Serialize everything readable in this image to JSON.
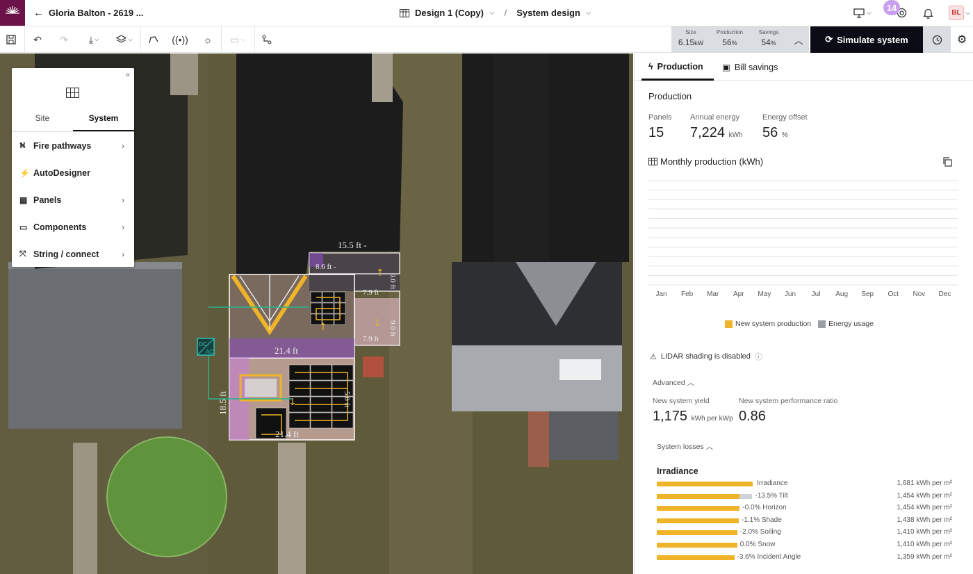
{
  "header": {
    "project_title": "Gloria Balton - 2619 ...",
    "design_name": "Design 1 (Copy)",
    "separator": "/",
    "page_name": "System design",
    "notification_count": "14",
    "avatar_initials": "BL"
  },
  "stats": {
    "size_label": "Size",
    "size_value": "6.15",
    "size_unit": "kW",
    "production_label": "Production",
    "production_value": "56",
    "production_unit": "%",
    "savings_label": "Savings",
    "savings_value": "54",
    "savings_unit": "%"
  },
  "simulate_label": "Simulate system",
  "left_panel": {
    "tabs": [
      "Site",
      "System"
    ],
    "active_tab": "System",
    "items": [
      {
        "label": "Fire pathways",
        "icon": "fire-pathway-icon",
        "chevron": true
      },
      {
        "label": "AutoDesigner",
        "icon": "magic-wand-icon",
        "chevron": false
      },
      {
        "label": "Panels",
        "icon": "grid-icon",
        "chevron": true
      },
      {
        "label": "Components",
        "icon": "component-icon",
        "chevron": true
      },
      {
        "label": "String / connect",
        "icon": "string-icon",
        "chevron": true
      }
    ]
  },
  "map_labels": {
    "dim1": "15.5 ft -",
    "dim2": "8.6 ft -",
    "dim3": "9.0 ft",
    "dim4": "7.9 ft",
    "dim5": "21.4 ft",
    "dim6": "7.9 ft",
    "dim7": "9.0 ft",
    "dim8": "18.5 ft",
    "dim9": "21.4 ft",
    "dim10": "5.8 ft",
    "dcac_top": "DC",
    "dcac_bottom": "AC"
  },
  "right_panel": {
    "tabs": [
      {
        "label": "Production"
      },
      {
        "label": "Bill savings"
      }
    ],
    "section_title": "Production",
    "panels_label": "Panels",
    "panels_value": "15",
    "annual_label": "Annual energy",
    "annual_value": "7,224",
    "annual_unit": "kWh",
    "offset_label": "Energy offset",
    "offset_value": "56",
    "offset_unit": "%",
    "monthly_title": "Monthly production (kWh)",
    "legend_production": "New system production",
    "legend_usage": "Energy usage",
    "lidar_text": "LIDAR shading is disabled",
    "advanced_label": "Advanced",
    "yield_label": "New system yield",
    "yield_value": "1,175",
    "yield_unit": "kWh per kWp",
    "ratio_label": "New system performance ratio",
    "ratio_value": "0.86",
    "losses_label": "System losses",
    "irradiance_title": "Irradiance",
    "losses": [
      {
        "label": "Irradiance",
        "value": "1,681 kWh per m²",
        "fraction": 1.0
      },
      {
        "label": "-13.5% Tilt",
        "value": "1,454 kWh per m²",
        "fraction": 0.865
      },
      {
        "label": "-0.0% Horizon",
        "value": "1,454 kWh per m²",
        "fraction": 0.865
      },
      {
        "label": "-1.1% Shade",
        "value": "1,438 kWh per m²",
        "fraction": 0.855
      },
      {
        "label": "-2.0% Soiling",
        "value": "1,410 kWh per m²",
        "fraction": 0.839
      },
      {
        "label": "0.0% Snow",
        "value": "1,410 kWh per m²",
        "fraction": 0.839
      },
      {
        "label": "-3.6% Incident Angle",
        "value": "1,359 kWh per m²",
        "fraction": 0.808
      }
    ]
  },
  "chart_data": {
    "type": "bar",
    "title": "Monthly production (kWh)",
    "categories": [
      "Jan",
      "Feb",
      "Mar",
      "Apr",
      "May",
      "Jun",
      "Jul",
      "Aug",
      "Sep",
      "Oct",
      "Nov",
      "Dec"
    ],
    "series": [
      {
        "name": "New system production",
        "values": []
      },
      {
        "name": "Energy usage",
        "values": []
      }
    ],
    "colors": {
      "production": "#f0b429",
      "usage": "#9aa0a6"
    },
    "grid": true,
    "legend_position": "bottom"
  }
}
